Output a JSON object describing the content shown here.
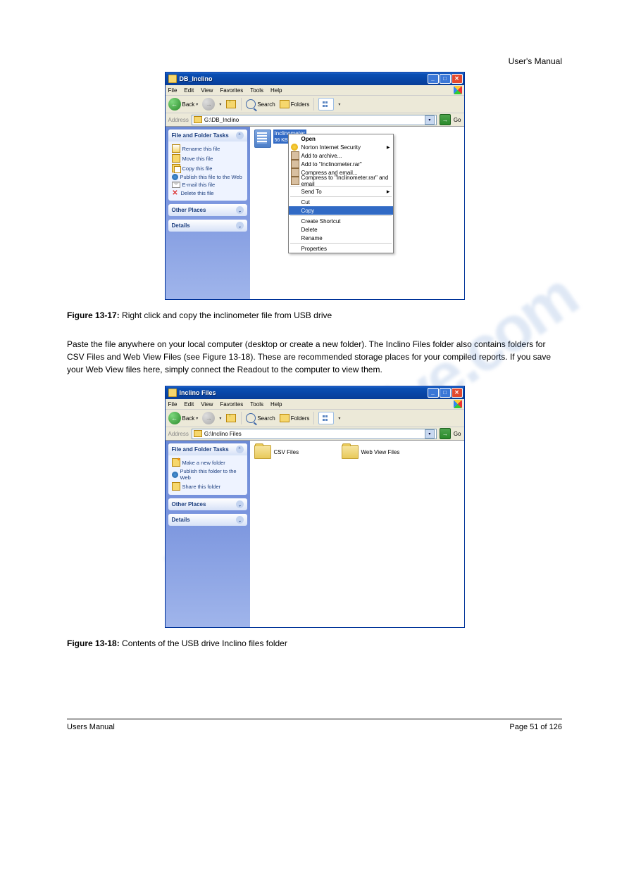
{
  "page": {
    "fig1_head": "User's Manual",
    "caption1_label": "Figure 13-17:",
    "caption1_text": " Right click and copy the inclinometer file from USB drive",
    "para1": "Paste the file anywhere on your local computer (desktop or create a new folder). The Inclino Files folder also contains folders for CSV Files and Web View Files (see Figure 13-18). These are recommended storage places for your compiled reports. If you save your Web View files here, simply connect the Readout to the computer to view them.",
    "caption2_label": "Figure 13-18:",
    "caption2_text": " Contents of the USB drive Inclino files folder",
    "footer_left": "Users Manual",
    "footer_right": "Page 51 of 126"
  },
  "win1": {
    "title": "DB_Inclino",
    "menu": [
      "File",
      "Edit",
      "View",
      "Favorites",
      "Tools",
      "Help"
    ],
    "toolbar": {
      "back": "Back",
      "search": "Search",
      "folders": "Folders"
    },
    "address_label": "Address",
    "address": "G:\\DB_Inclino",
    "go": "Go",
    "tasks_header": "File and Folder Tasks",
    "tasks": [
      "Rename this file",
      "Move this file",
      "Copy this file",
      "Publish this file to the Web",
      "E-mail this file",
      "Delete this file"
    ],
    "other_places": "Other Places",
    "details": "Details",
    "file_name": "Inclinometer",
    "file_size": "56 KB",
    "ctx": {
      "open": "Open",
      "norton": "Norton Internet Security",
      "addarch": "Add to archive...",
      "addrar": "Add to \"Inclinometer.rar\"",
      "compemail": "Compress and email...",
      "comprar": "Compress to \"Inclinometer.rar\" and email",
      "sendto": "Send To",
      "cut": "Cut",
      "copy": "Copy",
      "shortcut": "Create Shortcut",
      "delete": "Delete",
      "rename": "Rename",
      "props": "Properties"
    }
  },
  "win2": {
    "title": "Inclino Files",
    "menu": [
      "File",
      "Edit",
      "View",
      "Favorites",
      "Tools",
      "Help"
    ],
    "toolbar": {
      "back": "Back",
      "search": "Search",
      "folders": "Folders"
    },
    "address_label": "Address",
    "address": "G:\\Inclino Files",
    "go": "Go",
    "tasks_header": "File and Folder Tasks",
    "tasks": [
      "Make a new folder",
      "Publish this folder to the Web",
      "Share this folder"
    ],
    "other_places": "Other Places",
    "details": "Details",
    "folder1": "CSV Files",
    "folder2": "Web View Files"
  },
  "watermark": "manualshive.com"
}
